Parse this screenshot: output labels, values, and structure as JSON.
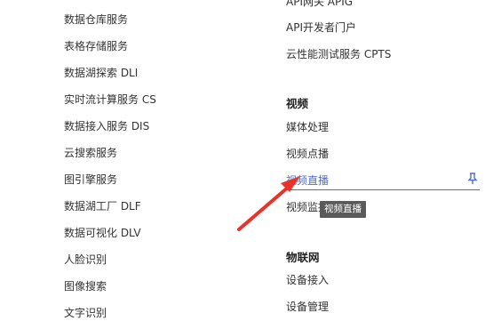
{
  "left_column": {
    "items": [
      "数据仓库服务",
      "表格存储服务",
      "数据湖探索 DLI",
      "实时流计算服务 CS",
      "数据接入服务 DIS",
      "云搜索服务",
      "图引擎服务",
      "数据湖工厂 DLF",
      "数据可视化 DLV",
      "人脸识别",
      "图像搜索",
      "文字识别"
    ]
  },
  "right_column": {
    "top_items": [
      "API网关 APIG",
      "API开发者门户",
      "云性能测试服务 CPTS"
    ],
    "video": {
      "title": "视频",
      "items": [
        "媒体处理",
        "视频点播",
        "视频直播",
        "视频监控"
      ]
    },
    "iot": {
      "title": "物联网",
      "items": [
        "设备接入",
        "设备管理"
      ]
    }
  },
  "tooltip": {
    "text": "视频直播"
  },
  "colors": {
    "accent": "#526ecc",
    "arrow": "#e8322a",
    "tooltip_bg": "#5a5a5a"
  },
  "icons": {
    "pin": "pin-icon"
  }
}
